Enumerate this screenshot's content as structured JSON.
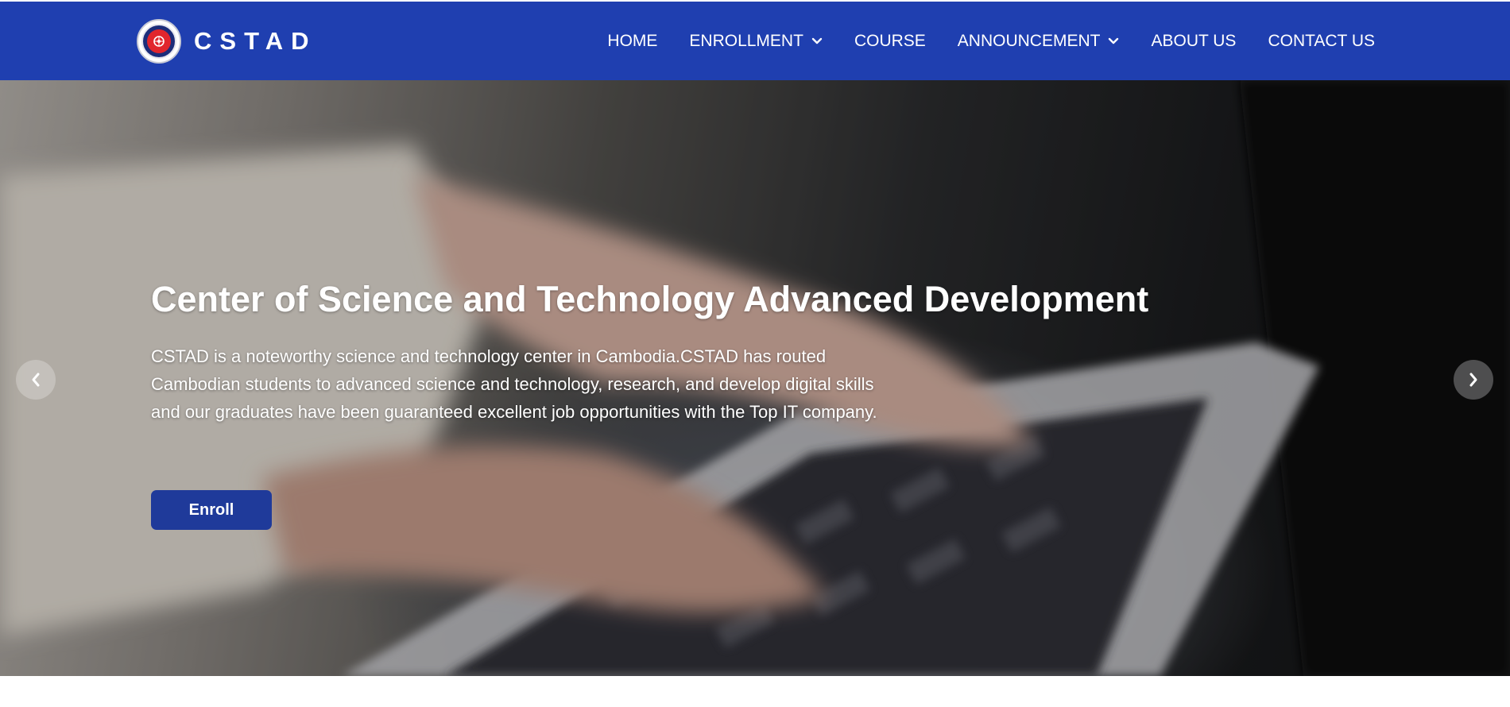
{
  "brand": {
    "name": "CSTAD",
    "logo_icon": "cstad-seal-logo-icon"
  },
  "nav": {
    "items": [
      {
        "label": "HOME",
        "has_dropdown": false
      },
      {
        "label": "ENROLLMENT",
        "has_dropdown": true
      },
      {
        "label": "COURSE",
        "has_dropdown": false
      },
      {
        "label": "ANNOUNCEMENT",
        "has_dropdown": true
      },
      {
        "label": "ABOUT US",
        "has_dropdown": false
      },
      {
        "label": "CONTACT US",
        "has_dropdown": false
      }
    ]
  },
  "hero": {
    "title": "Center of Science and Technology Advanced Development",
    "description": "CSTAD is a noteworthy science and technology center in Cambodia.CSTAD has routed Cambodian students to advanced science and technology, research, and develop digital skills and our graduates have been guaranteed excellent job opportunities with the Top IT company.",
    "cta_label": "Enroll",
    "prev_icon": "chevron-left-icon",
    "next_icon": "chevron-right-icon"
  },
  "colors": {
    "navbar_bg": "#1f3fb0",
    "button_bg": "#1f3a9a",
    "text": "#ffffff"
  }
}
